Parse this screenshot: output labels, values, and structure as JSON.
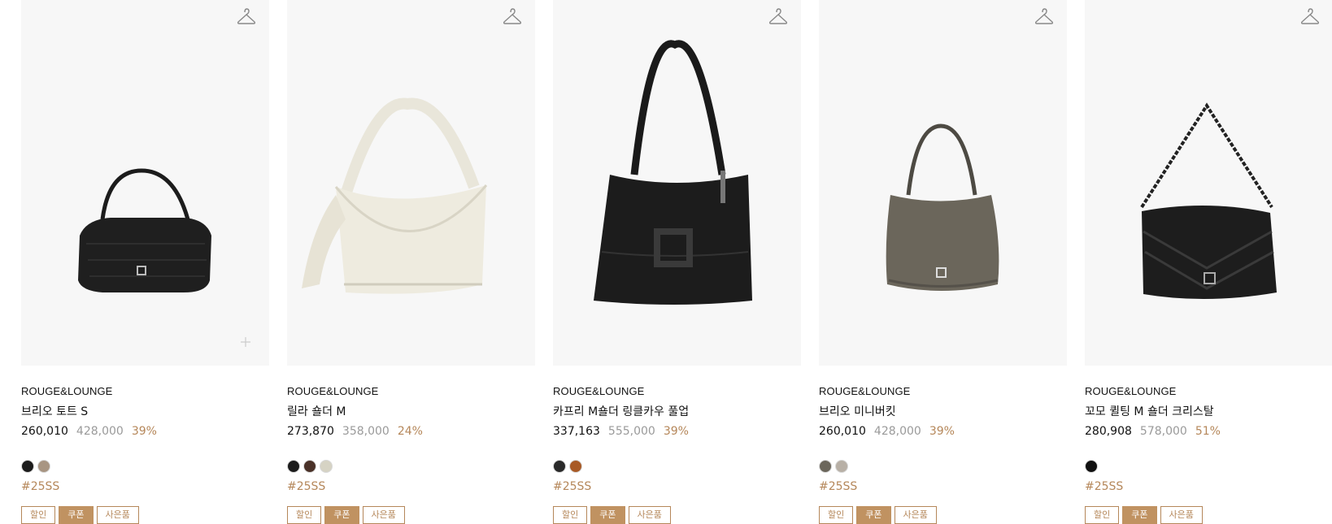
{
  "products": [
    {
      "brand": "ROUGE&LOUNGE",
      "name": "브리오 토트 S",
      "sale_price": "260,010",
      "original_price": "428,000",
      "discount": "39%",
      "colors": [
        "#1c1c1c",
        "#a89582"
      ],
      "tag": "#25SS",
      "badges": [
        "할인",
        "쿠폰",
        "사은품"
      ]
    },
    {
      "brand": "ROUGE&LOUNGE",
      "name": "릴라 숄더 M",
      "sale_price": "273,870",
      "original_price": "358,000",
      "discount": "24%",
      "colors": [
        "#1c1c1c",
        "#4a3128",
        "#d6d3c4"
      ],
      "tag": "#25SS",
      "badges": [
        "할인",
        "쿠폰",
        "사은품"
      ]
    },
    {
      "brand": "ROUGE&LOUNGE",
      "name": "카프리 M숄더 링클카우 풀업",
      "sale_price": "337,163",
      "original_price": "555,000",
      "discount": "39%",
      "colors": [
        "#2a2a2a",
        "#a85a26"
      ],
      "tag": "#25SS",
      "badges": [
        "할인",
        "쿠폰",
        "사은품"
      ]
    },
    {
      "brand": "ROUGE&LOUNGE",
      "name": "브리오 미니버킷",
      "sale_price": "260,010",
      "original_price": "428,000",
      "discount": "39%",
      "colors": [
        "#6b665b",
        "#b8b0a6"
      ],
      "tag": "#25SS",
      "badges": [
        "할인",
        "쿠폰",
        "사은품"
      ]
    },
    {
      "brand": "ROUGE&LOUNGE",
      "name": "꼬모 퀼팅 M 숄더 크리스탈",
      "sale_price": "280,908",
      "original_price": "578,000",
      "discount": "51%",
      "colors": [
        "#111111"
      ],
      "tag": "#25SS",
      "badges": [
        "할인",
        "쿠폰",
        "사은품"
      ]
    }
  ]
}
